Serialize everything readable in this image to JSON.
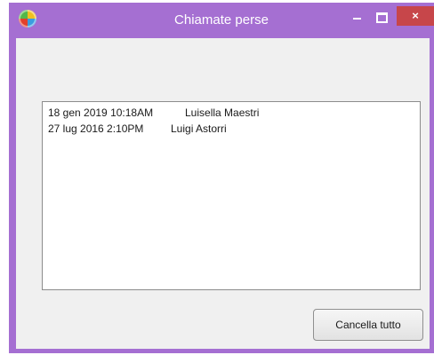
{
  "window": {
    "title": "Chiamate perse",
    "accent_color": "#a56fd2",
    "close_color": "#c7464a",
    "app_icon": "app-logo-icon",
    "controls": {
      "minimize_icon": "minimize-icon",
      "maximize_icon": "maximize-icon",
      "close_glyph": "×"
    }
  },
  "missed_calls": [
    {
      "date": "18 gen 2019  10:18AM",
      "name": "Luisella Maestri"
    },
    {
      "date": "27 lug 2016  2:10PM",
      "name": "Luigi Astorri"
    }
  ],
  "actions": {
    "clear_all_label": "Cancella tutto"
  }
}
